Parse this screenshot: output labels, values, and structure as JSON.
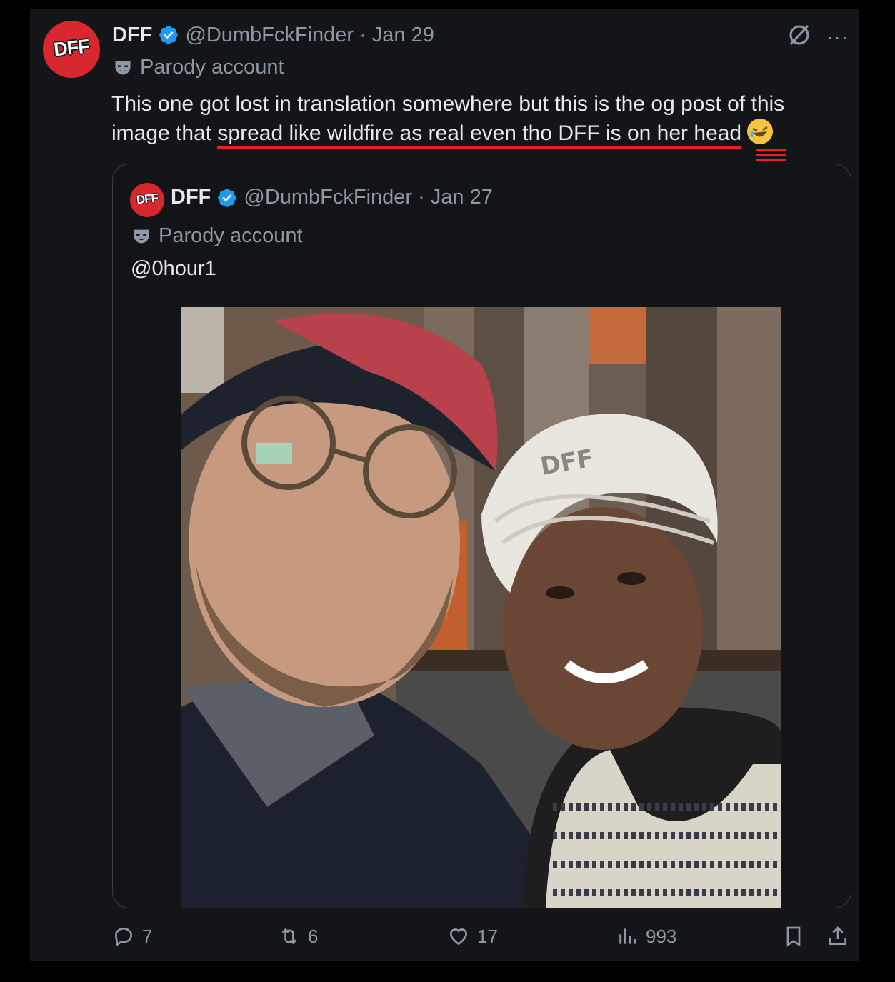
{
  "tweet": {
    "display_name": "DFF",
    "handle": "@DumbFckFinder",
    "separator": "·",
    "date": "Jan 29",
    "avatar_text": "DFF",
    "parody_label": "Parody account",
    "text_before": "This one got lost in translation somewhere but this is the og post of this image that ",
    "text_highlight": "spread like wildfire as real even tho DFF is on her head",
    "emoji": "🤣",
    "more_icon": "···"
  },
  "quote": {
    "display_name": "DFF",
    "handle": "@DumbFckFinder",
    "separator": "·",
    "date": "Jan 27",
    "avatar_text": "DFF",
    "parody_label": "Parody account",
    "text": "@0hour1",
    "photo_watermark": "DFF"
  },
  "actions": {
    "replies": "7",
    "reposts": "6",
    "likes": "17",
    "views": "993"
  },
  "colors": {
    "background": "#141518",
    "verified": "#1d9bf0",
    "highlight_underline": "#e8202a",
    "muted": "#8b98a5"
  },
  "icons": [
    "verified-badge-icon",
    "parody-mask-icon",
    "no-follow-icon",
    "more-icon",
    "reply-icon",
    "repost-icon",
    "like-icon",
    "views-icon",
    "bookmark-icon",
    "share-icon"
  ]
}
